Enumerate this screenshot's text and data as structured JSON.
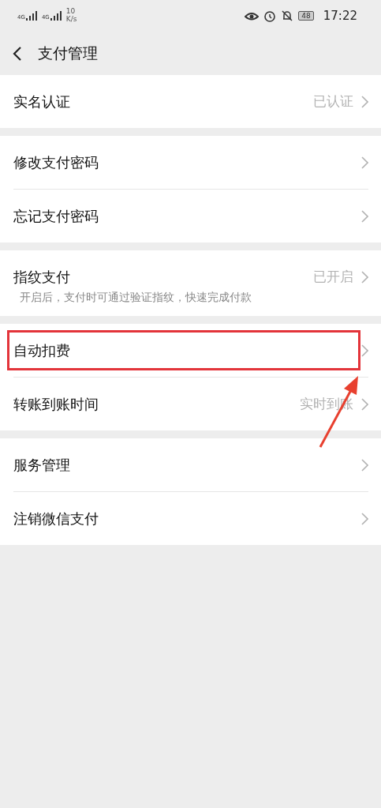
{
  "status_bar": {
    "networks": [
      {
        "label": "4G"
      },
      {
        "label": "4G"
      }
    ],
    "speed_value": "10",
    "speed_unit": "K/s",
    "battery": "48",
    "time": "17:22"
  },
  "header": {
    "title": "支付管理"
  },
  "groups": [
    {
      "rows": [
        {
          "label": "实名认证",
          "value": "已认证",
          "highlighted": false
        }
      ]
    },
    {
      "rows": [
        {
          "label": "修改支付密码",
          "highlighted": false
        },
        {
          "label": "忘记支付密码",
          "highlighted": false
        }
      ]
    },
    {
      "rows": [
        {
          "label": "指纹支付",
          "value": "已开启",
          "note": "开启后，支付时可通过验证指纹，快速完成付款",
          "highlighted": false
        }
      ]
    },
    {
      "rows": [
        {
          "label": "自动扣费",
          "highlighted": true
        },
        {
          "label": "转账到账时间",
          "value": "实时到账",
          "highlighted": false
        }
      ]
    },
    {
      "rows": [
        {
          "label": "服务管理",
          "highlighted": false
        },
        {
          "label": "注销微信支付",
          "highlighted": false
        }
      ]
    }
  ]
}
